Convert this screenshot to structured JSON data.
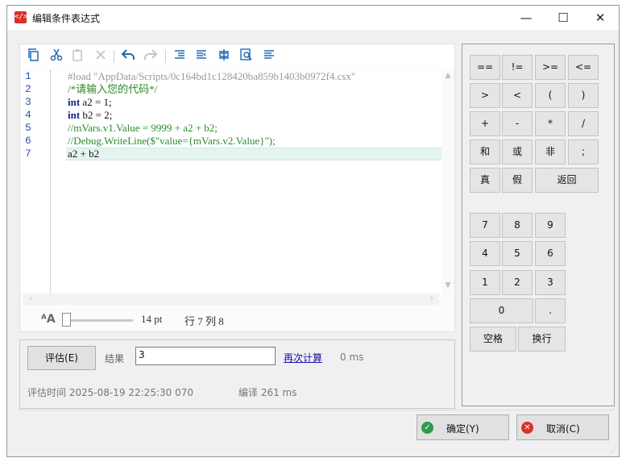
{
  "window": {
    "title": "编辑条件表达式",
    "app_icon_glyph": "</>",
    "controls": {
      "minimize": "—",
      "maximize": "☐",
      "close": "✕"
    }
  },
  "toolbar": {
    "icons": [
      "copy-icon",
      "cut-icon",
      "paste-icon",
      "delete-icon",
      "undo-icon",
      "redo-icon",
      "indent-icon",
      "outdent-icon",
      "format-icon",
      "find-icon",
      "align-icon"
    ]
  },
  "editor": {
    "line_numbers": [
      "1",
      "2",
      "3",
      "4",
      "5",
      "6",
      "7"
    ],
    "lines": {
      "l1": "#load \"AppData/Scripts/0c164bd1c128420ba859b1403b0972f4.csx\"",
      "l2": "/*请输入您的代码*/",
      "l3_kw": "int",
      "l3_rest": " a2 = 1;",
      "l4_kw": "int",
      "l4_rest": " b2 = 2;",
      "l5": "//mVars.v1.Value = 9999 + a2 + b2;",
      "l6": "//Debug.WriteLine($\"value={mVars.v2.Value}\");",
      "l7": "a2 + b2"
    },
    "current_line_color": "#e6f4f0",
    "comment_color": "#2b8a2b",
    "keyword_color": "#1a237e"
  },
  "statusbar": {
    "zoom_icon_text": "ᴬA",
    "zoom_value": "14 pt",
    "cursor_pos": "行 7 列 8",
    "zoom_level": 14
  },
  "evaluate": {
    "button": "评估(E)",
    "result_label": "结果",
    "result_value": "3",
    "recalc_link": "再次计算",
    "eval_ms": "0 ms",
    "eval_time": "评估时间 2025-08-19 22:25:30 070",
    "compile_time": "编译 261 ms"
  },
  "keypad": {
    "ops": [
      "==",
      "!=",
      ">=",
      "<=",
      ">",
      "<",
      "(",
      ")",
      "+",
      "-",
      "*",
      "/",
      "和",
      "或",
      "非",
      ";",
      "真",
      "假"
    ],
    "back": "返回",
    "digits": [
      "7",
      "8",
      "9",
      "4",
      "5",
      "6",
      "1",
      "2",
      "3"
    ],
    "zero": "0",
    "dot": ".",
    "space": "空格",
    "newline": "换行"
  },
  "dialog": {
    "ok": "确定(Y)",
    "cancel": "取消(C)",
    "ok_color": "#2e9c4a",
    "cancel_color": "#d9302a"
  }
}
